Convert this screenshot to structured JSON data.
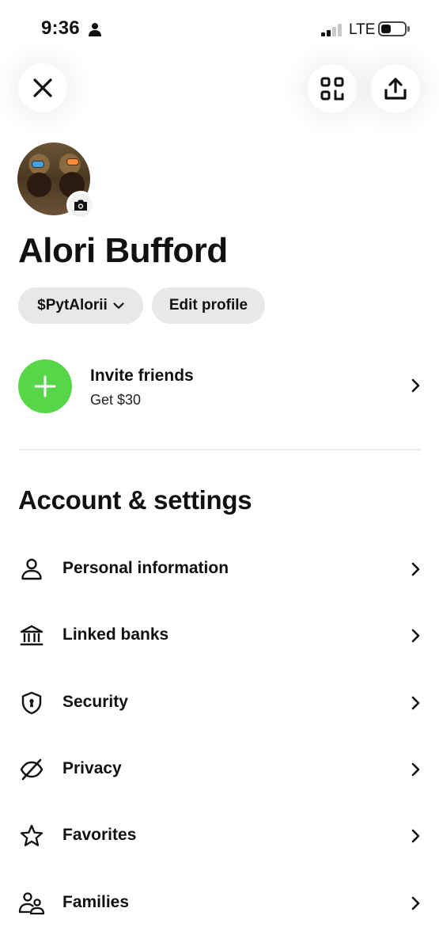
{
  "status_bar": {
    "time": "9:36",
    "network": "LTE",
    "signal_bars_filled": 2,
    "signal_bars_total": 4,
    "battery_level": 0.4
  },
  "header": {
    "close_icon": "close-icon",
    "qr_icon": "qr-scan-icon",
    "share_icon": "share-icon"
  },
  "profile": {
    "name": "Alori Bufford",
    "cashtag": "$PytAlorii",
    "edit_label": "Edit profile"
  },
  "invite": {
    "title": "Invite friends",
    "subtitle": "Get $30",
    "accent_color": "#58d64a"
  },
  "settings": {
    "title": "Account & settings",
    "items": [
      {
        "label": "Personal information",
        "icon": "person-icon"
      },
      {
        "label": "Linked banks",
        "icon": "bank-icon"
      },
      {
        "label": "Security",
        "icon": "shield-icon"
      },
      {
        "label": "Privacy",
        "icon": "eye-off-icon"
      },
      {
        "label": "Favorites",
        "icon": "star-icon"
      },
      {
        "label": "Families",
        "icon": "family-icon"
      }
    ]
  }
}
